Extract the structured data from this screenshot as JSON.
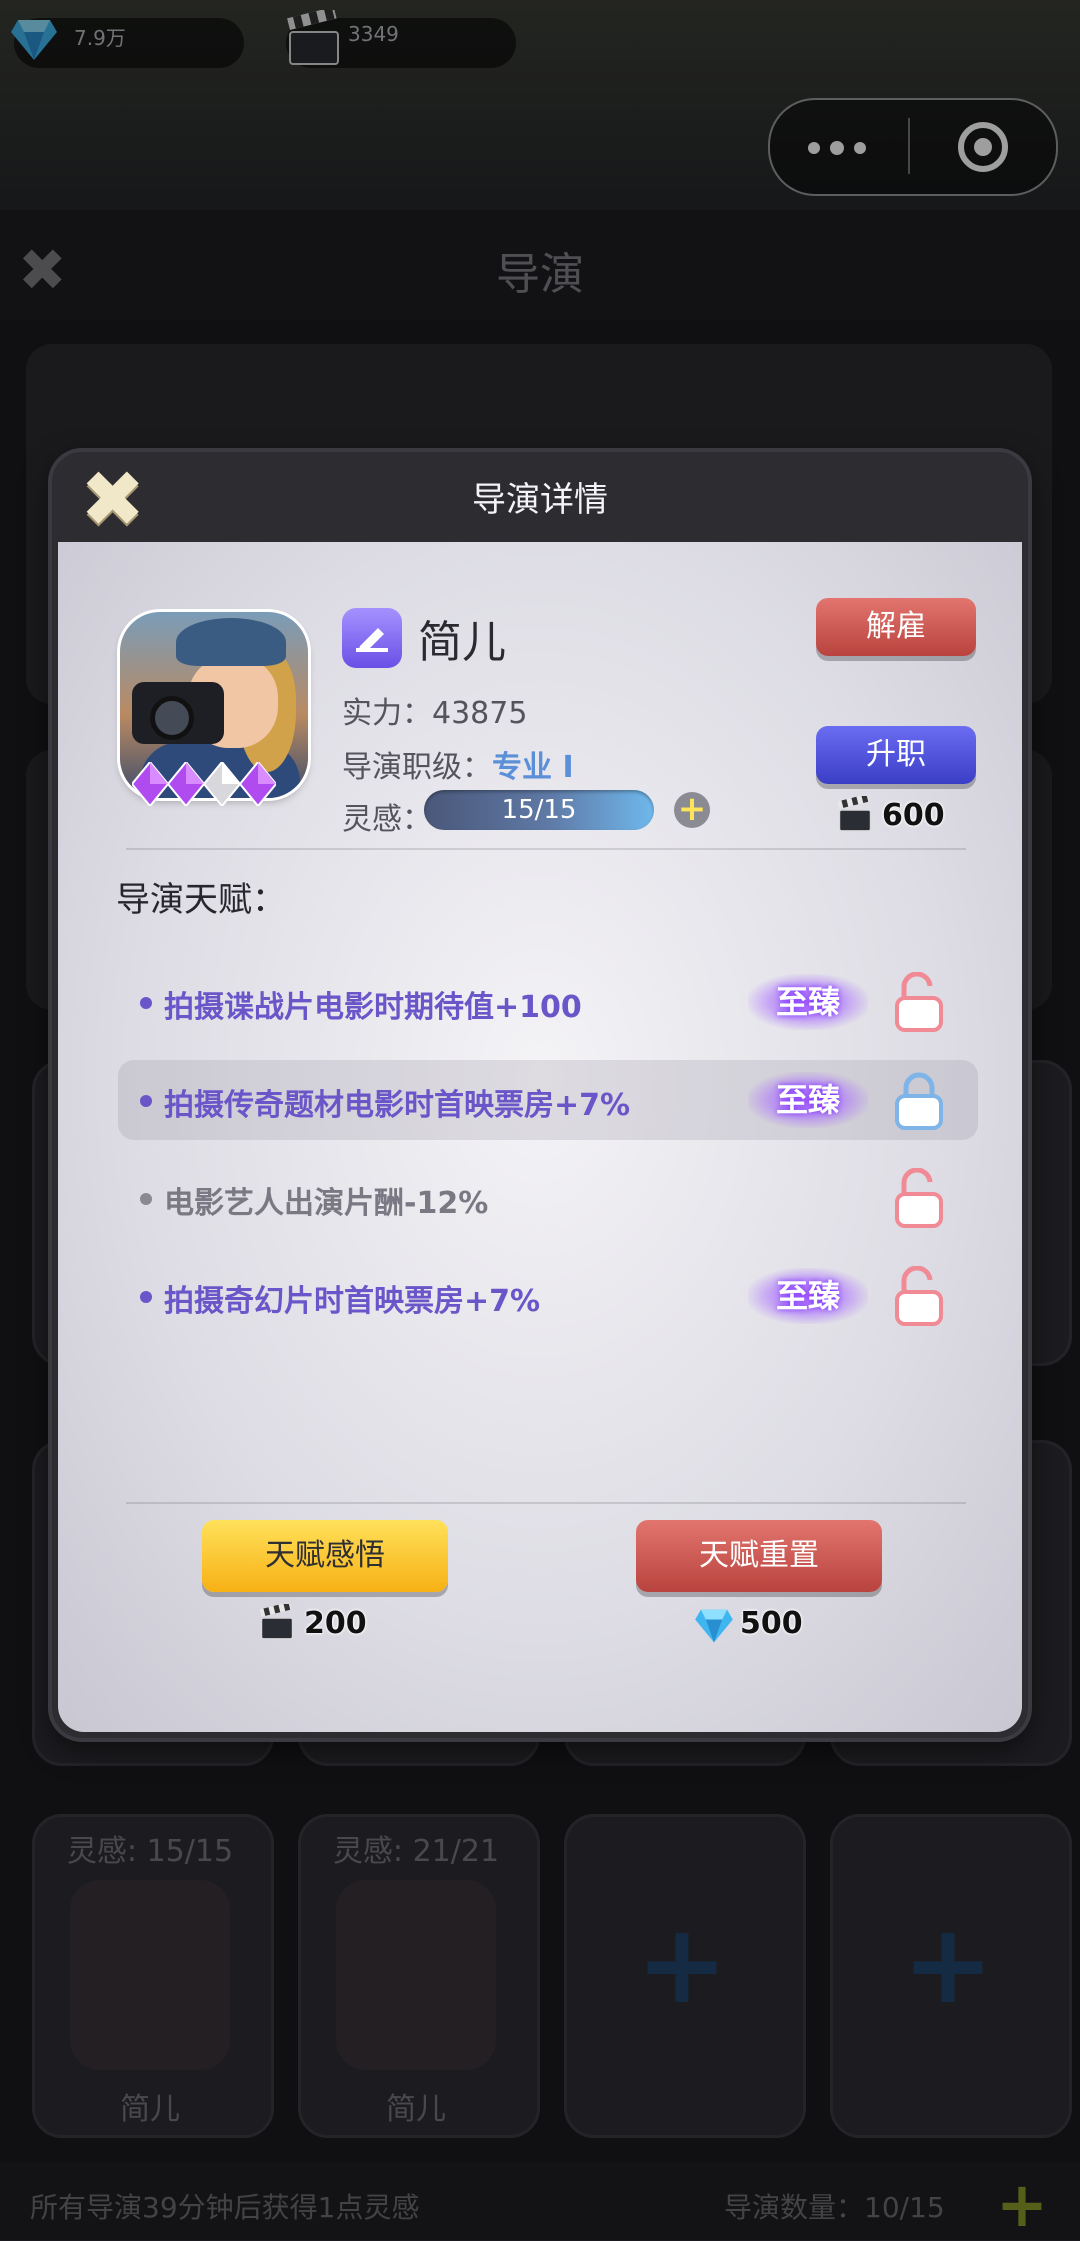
{
  "status_bar": {
    "diamonds": "7.9万",
    "film": "3349"
  },
  "page": {
    "title": "导演",
    "close_glyph": "✖"
  },
  "director_slots": [
    {
      "inspiration": "灵感: 15/15",
      "name": "简儿"
    },
    {
      "inspiration": "灵感: 21/21",
      "name": "简儿"
    },
    {
      "add": "+"
    },
    {
      "add": "+"
    }
  ],
  "footer": {
    "tip": "所有导演39分钟后获得1点灵感",
    "count": "导演数量：10/15"
  },
  "modal": {
    "title": "导演详情",
    "name": "简儿",
    "strength_label": "实力：",
    "strength_value": "43875",
    "rank_label": "导演职级：",
    "rank_value": "专业 Ⅰ",
    "inspiration_label": "灵感：",
    "inspiration_value": "15/15",
    "inspiration_progress": 1.0,
    "fire_button": "解雇",
    "promote_button": "升职",
    "promote_cost": "600",
    "talents_heading": "导演天赋：",
    "talents": [
      {
        "text": "拍摄谍战片电影时期待值+100",
        "tier": "至臻",
        "locked": false,
        "style": "purple"
      },
      {
        "text": "拍摄传奇题材电影时首映票房+7%",
        "tier": "至臻",
        "locked": true,
        "style": "purple"
      },
      {
        "text": "电影艺人出演片酬-12%",
        "tier": "",
        "locked": false,
        "style": "gray"
      },
      {
        "text": "拍摄奇幻片时首映票房+7%",
        "tier": "至臻",
        "locked": false,
        "style": "purple"
      }
    ],
    "comprehend_button": "天赋感悟",
    "comprehend_cost": "200",
    "reset_button": "天赋重置",
    "reset_cost": "500"
  },
  "colors": {
    "purple_text": "#6a56c9",
    "rank_blue": "#5b8fd8",
    "fire_red": "#c24c46",
    "promote_blue": "#4a4de0",
    "comprehend_yellow": "#fbc632"
  },
  "icons": [
    "diamond-icon",
    "clapperboard-icon",
    "more-dots-icon",
    "target-icon",
    "close-icon",
    "pen-icon",
    "plus-icon",
    "padlock-open-icon",
    "padlock-closed-icon",
    "rank-gem-icon"
  ]
}
